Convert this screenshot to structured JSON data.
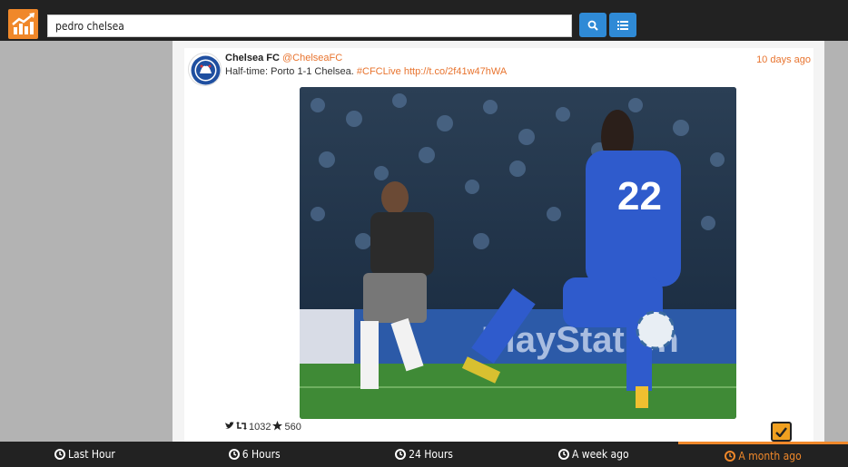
{
  "search": {
    "value": "pedro chelsea"
  },
  "tweet": {
    "name": "Chelsea FC",
    "handle": "@ChelseaFC",
    "text": "Half-time: Porto 1-1 Chelsea. ",
    "hashtag": "#CFCLive",
    "link": "http://t.co/2f41w47hWA",
    "time_ago": "10 days ago",
    "retweets": "1032",
    "favorites": "560"
  },
  "nav": {
    "tabs": [
      {
        "label": "Last Hour"
      },
      {
        "label": "6 Hours"
      },
      {
        "label": "24 Hours"
      },
      {
        "label": "A week ago"
      },
      {
        "label": "A month ago",
        "active": true
      }
    ]
  },
  "colors": {
    "accent": "#f0882a",
    "button": "#2f8ad6",
    "bar": "#222222"
  },
  "icons": [
    "trending-logo-icon",
    "search-icon",
    "list-icon",
    "twitter-icon",
    "retweet-icon",
    "star-icon",
    "checkmark-icon",
    "clock-icon"
  ]
}
